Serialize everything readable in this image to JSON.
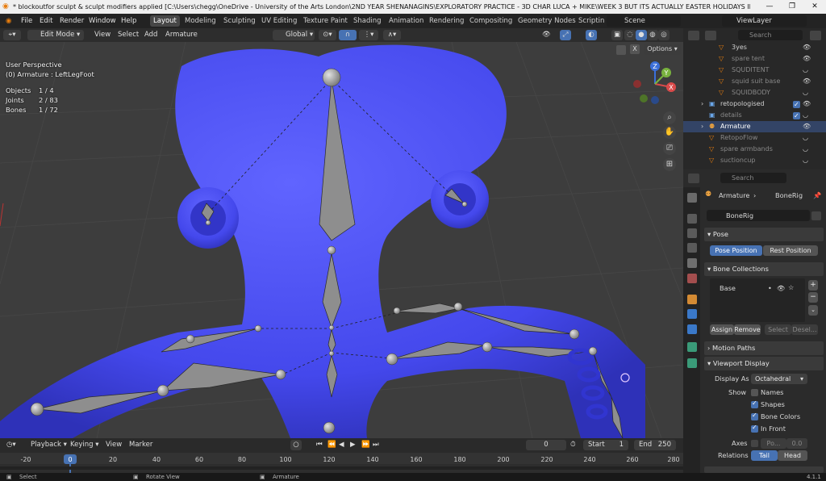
{
  "title": "* blockoutfor sculpt & sculpt modifiers applied [C:\\Users\\chegg\\OneDrive - University of the Arts London\\2ND YEAR SHENANAGINS\\EXPLORATORY PRACTICE - 3D CHAR LUCA + MIKE\\WEEK 3 BUT ITS ACTUALLY EASTER HOLIDAYS IM LAZY\\block...",
  "menu": [
    "File",
    "Edit",
    "Render",
    "Window",
    "Help"
  ],
  "workspaces": [
    "Layout",
    "Modeling",
    "Sculpting",
    "UV Editing",
    "Texture Paint",
    "Shading",
    "Animation",
    "Rendering",
    "Compositing",
    "Geometry Nodes",
    "Scriptin"
  ],
  "scene": "Scene",
  "view_layer": "ViewLayer",
  "viewport_header": {
    "mode": "Edit Mode",
    "menus": [
      "View",
      "Select",
      "Add",
      "Armature"
    ],
    "orientation": "Global"
  },
  "overlay": {
    "perspective": "User Perspective",
    "active": "(0) Armature : LeftLegFoot",
    "stats": [
      {
        "label": "Objects",
        "value": "1 / 4"
      },
      {
        "label": "Joints",
        "value": "2 / 83"
      },
      {
        "label": "Bones",
        "value": "1 / 72"
      }
    ],
    "options": "Options"
  },
  "gizmo": {
    "x": "X",
    "y": "Y",
    "z": "Z"
  },
  "outliner": {
    "search_placeholder": "Search",
    "rows": [
      "3yes",
      "spare tent",
      "SQUDITENT",
      "squid suit base",
      "SQUIDBODY",
      "retopologised",
      "details",
      "Armature",
      "RetopoFlow",
      "spare armbands",
      "suctioncup"
    ]
  },
  "properties": {
    "search_placeholder": "Search",
    "breadcrumb": [
      "Armature",
      "BoneRig"
    ],
    "data_name": "BoneRig",
    "pose": {
      "title": "Pose",
      "pose_position": "Pose Position",
      "rest_position": "Rest Position"
    },
    "bone_collections": {
      "title": "Bone Collections",
      "item": "Base",
      "assign": "Assign",
      "remove": "Remove",
      "select": "Select",
      "deselect": "Desel..."
    },
    "motion_paths": "Motion Paths",
    "viewport_display": {
      "title": "Viewport Display",
      "display_as_label": "Display As",
      "display_as": "Octahedral",
      "show_label": "Show",
      "names": "Names",
      "shapes": "Shapes",
      "bone_colors": "Bone Colors",
      "in_front": "In Front",
      "axes_label": "Axes",
      "axes_pos": "Po...",
      "axes_value": "0.0",
      "relations_label": "Relations",
      "tail": "Tail",
      "head": "Head"
    }
  },
  "timeline": {
    "menus": [
      "Playback",
      "Keying",
      "View",
      "Marker"
    ],
    "current_frame": "0",
    "start_label": "Start",
    "start": "1",
    "end_label": "End",
    "end": "250",
    "ticks": [
      "-20",
      "0",
      "20",
      "40",
      "60",
      "80",
      "100",
      "120",
      "140",
      "160",
      "180",
      "200",
      "220",
      "240",
      "260",
      "280"
    ]
  },
  "statusbar": {
    "left": "Select",
    "middle": "Rotate View",
    "right": "Armature",
    "version": "4.1.1"
  },
  "colors": {
    "accent": "#4772b3",
    "mesh": "#4a4ef0",
    "bone": "#8c8c8c",
    "bg": "#3d3d3d"
  }
}
